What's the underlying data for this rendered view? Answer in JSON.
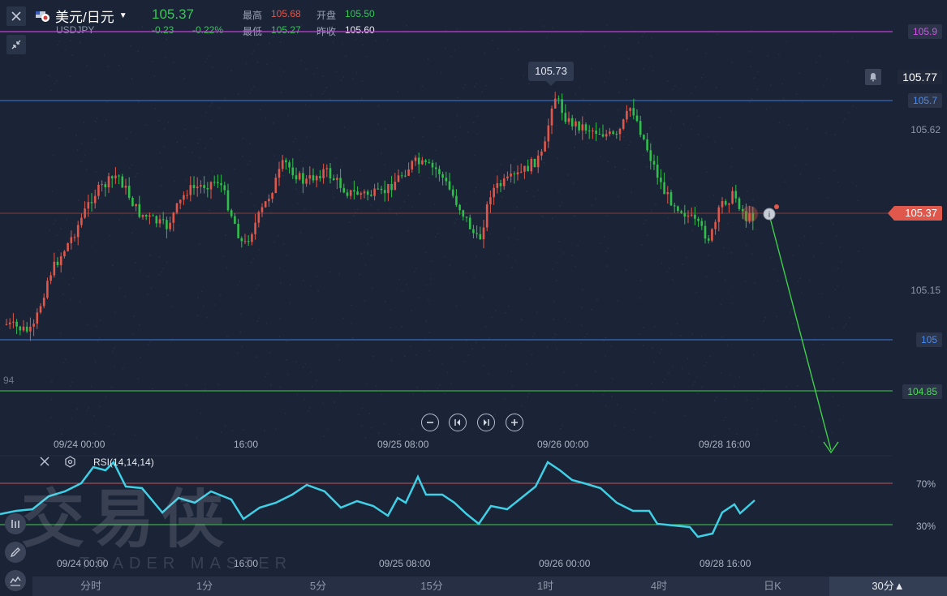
{
  "header": {
    "symbol_name": "美元/日元",
    "symbol_code": "USDJPY",
    "last_price": "105.37",
    "change": "-0.23",
    "change_pct": "-0.22%",
    "high_label": "最高",
    "high_value": "105.68",
    "open_label": "开盘",
    "open_value": "105.50",
    "low_label": "最低",
    "low_value": "105.27",
    "prev_close_label": "昨收",
    "prev_close_value": "105.60"
  },
  "price_axis": {
    "level_top": "105.9",
    "alert_value": "105.77",
    "level_blue_1": "105.7",
    "tick_1": "105.62",
    "current": "105.37",
    "tick_2": "105.15",
    "level_blue_2": "105",
    "level_green": "104.85",
    "left_clipped": "94"
  },
  "peak_label": "105.73",
  "time_axis_main": [
    "09/24 00:00",
    "16:00",
    "09/25 08:00",
    "09/26 00:00",
    "09/28 16:00"
  ],
  "time_axis_rsi": [
    "09/24 00:00",
    "16:00",
    "09/25 08:00",
    "09/26 00:00",
    "09/28 16:00"
  ],
  "rsi": {
    "label": "RSI(14,14,14)",
    "upper_label": "70%",
    "lower_label": "30%"
  },
  "watermark": {
    "main": "交易侠",
    "sub": "TRADER MASTER"
  },
  "timeframes": [
    "分时",
    "1分",
    "5分",
    "15分",
    "1时",
    "4时",
    "日K"
  ],
  "timeframe_selected": "30分▲",
  "colors": {
    "up": "#e0584b",
    "down": "#2fbf4a",
    "background": "#1b2336",
    "rsi_line": "#3fd0e6",
    "magenta_level": "#c23fd6",
    "blue_level": "#3d78e0",
    "green_level": "#3fcf4a"
  },
  "icons": [
    "close-icon",
    "compress-icon",
    "flag-icon",
    "caret-down-icon",
    "bell-icon",
    "zoom-out-icon",
    "scroll-left-icon",
    "scroll-right-icon",
    "zoom-in-icon",
    "gear-icon",
    "drawing-icon",
    "pencil-icon",
    "indicator-icon"
  ]
}
